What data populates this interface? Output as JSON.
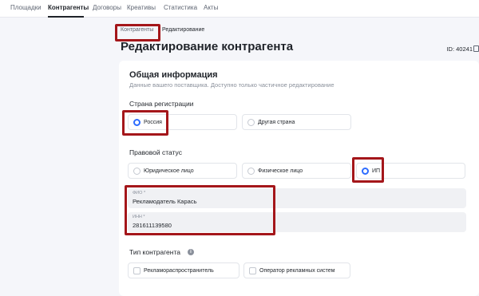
{
  "nav": {
    "tabs": [
      "Площадки",
      "Контрагенты",
      "Договоры",
      "Креативы",
      "Статистика",
      "Акты"
    ],
    "active_index": 1
  },
  "breadcrumb": {
    "items": [
      "Контрагенты",
      "Редактирование"
    ]
  },
  "page": {
    "title": "Редактирование контрагента",
    "id_text": "ID: 40241"
  },
  "general": {
    "title": "Общая информация",
    "subtitle": "Данные вашего поставщика. Доступно только частичное редактирование"
  },
  "country": {
    "label": "Страна регистрации",
    "options": [
      "Россия",
      "Другая страна"
    ],
    "selected_index": 0
  },
  "legal_status": {
    "label": "Правовой статус",
    "options": [
      "Юридическое лицо",
      "Физическое лицо",
      "ИП"
    ],
    "selected_index": 2
  },
  "fio": {
    "label": "ФИО *",
    "value": "Рекламодатель Карась"
  },
  "inn": {
    "label": "ИНН *",
    "value": "281611139580"
  },
  "contractor_type": {
    "label": "Тип контрагента",
    "info_glyph": "i",
    "options": [
      "Рекламораспространитель",
      "Оператор рекламных систем"
    ]
  },
  "colors": {
    "accent": "#2d6cff",
    "highlight": "#a4161a"
  },
  "icons": [
    "copy-icon",
    "info-icon",
    "radio-icon",
    "checkbox-icon"
  ]
}
